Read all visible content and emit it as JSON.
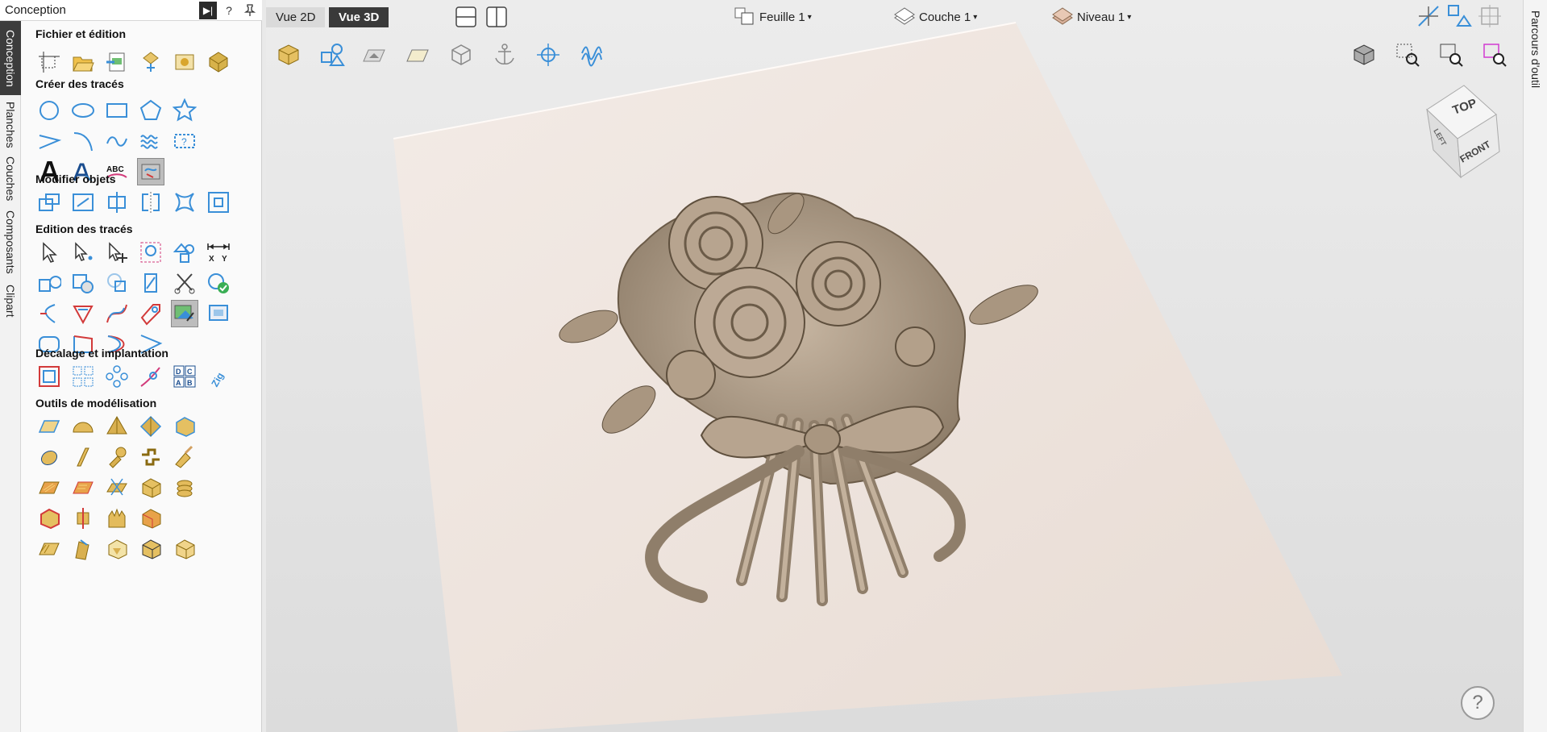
{
  "panel": {
    "title": "Conception",
    "help": "?",
    "sections": [
      {
        "title": "Fichier et édition"
      },
      {
        "title": "Créer des tracés"
      },
      {
        "title": "Modifier objets"
      },
      {
        "title": "Edition des tracés"
      },
      {
        "title": "Décalage et implantation"
      },
      {
        "title": "Outils de modélisation"
      }
    ]
  },
  "left_tabs": [
    "Conception",
    "Planches",
    "Couches",
    "Composants",
    "Clipart"
  ],
  "right_tabs": [
    "Parcours d'outil"
  ],
  "view_tabs": [
    "Vue 2D",
    "Vue 3D"
  ],
  "dropdowns": {
    "sheet": "Feuille 1",
    "layer": "Couche 1",
    "level": "Niveau 1"
  },
  "view_cube": {
    "top": "TOP",
    "front": "FRONT",
    "left": "LEFT"
  },
  "text_icons": {
    "abc": "ABC",
    "xy_x": "X",
    "xy_y": "Y",
    "grid": [
      "D",
      "C",
      "A",
      "B"
    ],
    "zig": "Zig"
  },
  "colors": {
    "accent": "#3a8fd8",
    "wood": "#b8a48f",
    "sheet": "#efe5df",
    "dark": "#3a3a3a"
  },
  "help_button": "?"
}
